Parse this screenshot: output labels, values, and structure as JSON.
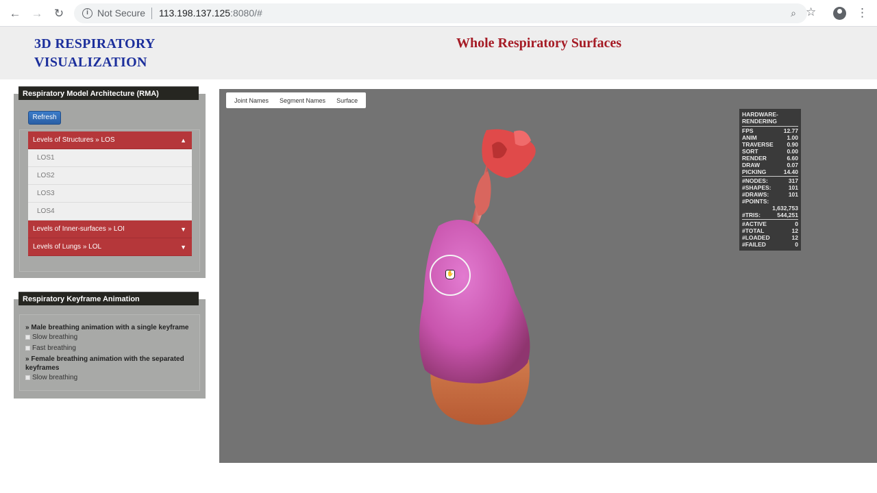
{
  "browser": {
    "security_label": "Not Secure",
    "url_host": "113.198.137.125",
    "url_rest": ":8080/#"
  },
  "header": {
    "site_title_line1": "3D RESPIRATORY",
    "site_title_line2": "VISUALIZATION",
    "page_title": "Whole Respiratory Surfaces"
  },
  "rma_panel": {
    "title": "Respiratory Model Architecture (RMA)",
    "refresh_label": "Refresh",
    "sections": [
      {
        "label": "Levels of Structures » LOS",
        "arrow": "▲",
        "items": [
          "LOS1",
          "LOS2",
          "LOS3",
          "LOS4"
        ]
      },
      {
        "label": "Levels of Inner-surfaces » LOI",
        "arrow": "▼"
      },
      {
        "label": "Levels of Lungs » LOL",
        "arrow": "▼"
      }
    ]
  },
  "animation_panel": {
    "title": "Respiratory Keyframe Animation",
    "groups": [
      {
        "label": "» Male breathing animation with a single keyframe",
        "options": [
          "Slow breathing",
          "Fast breathing"
        ]
      },
      {
        "label": "» Female breathing animation with the separated keyframes",
        "options": [
          "Slow breathing"
        ]
      }
    ]
  },
  "viewport": {
    "tabs": [
      "Joint Names",
      "Segment Names",
      "Surface"
    ],
    "stats": {
      "header": "HARDWARE-RENDERING",
      "timing": [
        {
          "k": "FPS",
          "v": "12.77"
        },
        {
          "k": "ANIM",
          "v": "1.00"
        },
        {
          "k": "TRAVERSE",
          "v": "0.90"
        },
        {
          "k": "SORT",
          "v": "0.00"
        },
        {
          "k": "RENDER",
          "v": "6.60"
        },
        {
          "k": "DRAW",
          "v": "0.07"
        },
        {
          "k": "PICKING",
          "v": "14.40"
        }
      ],
      "counts": [
        {
          "k": "#NODES:",
          "v": "317"
        },
        {
          "k": "#SHAPES:",
          "v": "101"
        },
        {
          "k": "#DRAWS:",
          "v": "101"
        },
        {
          "k": "#POINTS:",
          "v": ""
        }
      ],
      "points_value": "1,632,753",
      "tris": {
        "k": "#TRIS:",
        "v": "544,251"
      },
      "loading": [
        {
          "k": "#ACTIVE",
          "v": "0"
        },
        {
          "k": "#TOTAL",
          "v": "12"
        },
        {
          "k": "#LOADED",
          "v": "12"
        },
        {
          "k": "#FAILED",
          "v": "0"
        }
      ]
    }
  }
}
